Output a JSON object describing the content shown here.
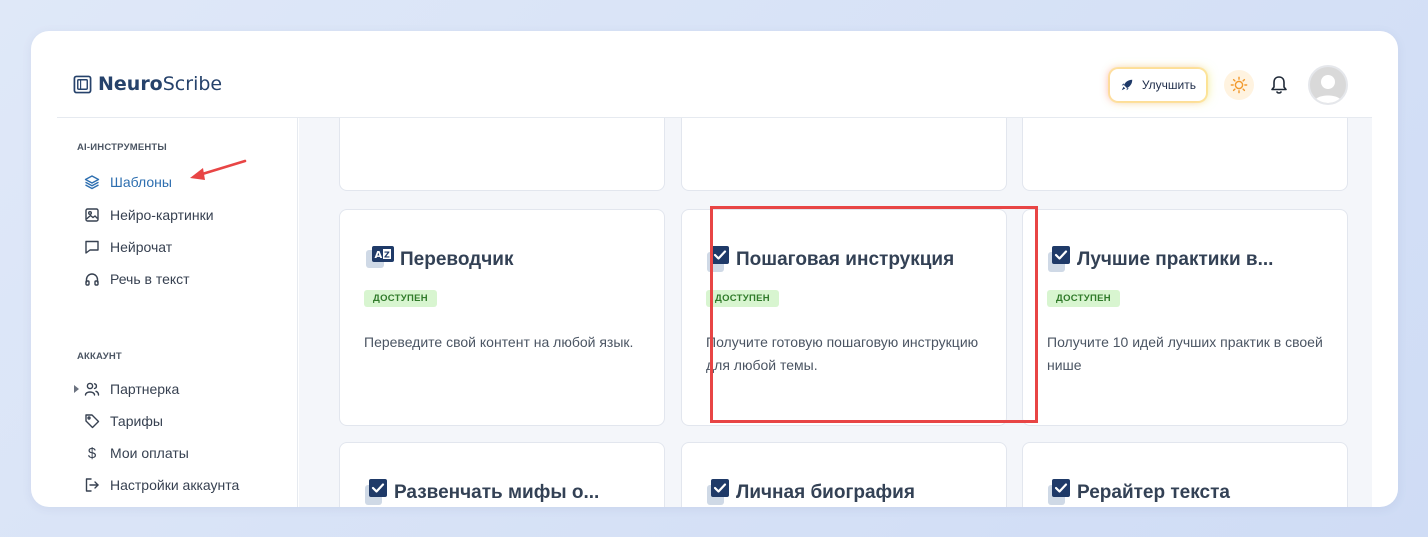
{
  "brand": {
    "name_bold": "Neuro",
    "name_rest": "Scribe"
  },
  "header": {
    "upgrade_label": "Улучшить"
  },
  "sidebar": {
    "section_ai": "AI-ИНСТРУМЕНТЫ",
    "ai_items": [
      {
        "label": "Шаблоны",
        "icon": "layers-icon",
        "active": true
      },
      {
        "label": "Нейро-картинки",
        "icon": "image-icon"
      },
      {
        "label": "Нейрочат",
        "icon": "chat-icon"
      },
      {
        "label": "Речь в текст",
        "icon": "headphones-icon"
      }
    ],
    "section_account": "АККАУНТ",
    "account_items": [
      {
        "label": "Партнерка",
        "icon": "users-icon"
      },
      {
        "label": "Тарифы",
        "icon": "tag-icon"
      },
      {
        "label": "Мои оплаты",
        "icon": "dollar-icon"
      },
      {
        "label": "Настройки аккаунта",
        "icon": "logout-icon"
      }
    ]
  },
  "cards": [
    {
      "title": "Переводчик",
      "icon": "translate-icon",
      "badge": "ДОСТУПЕН",
      "desc": "Переведите свой контент на любой язык."
    },
    {
      "title": "Пошаговая инструкция",
      "icon": "checkbox-icon",
      "badge": "ДОСТУПЕН",
      "desc": "Получите готовую пошаговую инструкцию для любой темы."
    },
    {
      "title": "Лучшие практики в...",
      "icon": "checkbox-icon",
      "badge": "ДОСТУПЕН",
      "desc": "Получите 10 идей лучших практик в своей нише"
    },
    {
      "title": "Развенчать мифы о...",
      "icon": "checkbox-icon"
    },
    {
      "title": "Личная биография",
      "icon": "checkbox-icon"
    },
    {
      "title": "Рерайтер текста",
      "icon": "checkbox-icon"
    }
  ],
  "colors": {
    "accent": "#2e6fb0",
    "highlight": "#e84545",
    "badge_bg": "#d8f5d0"
  }
}
